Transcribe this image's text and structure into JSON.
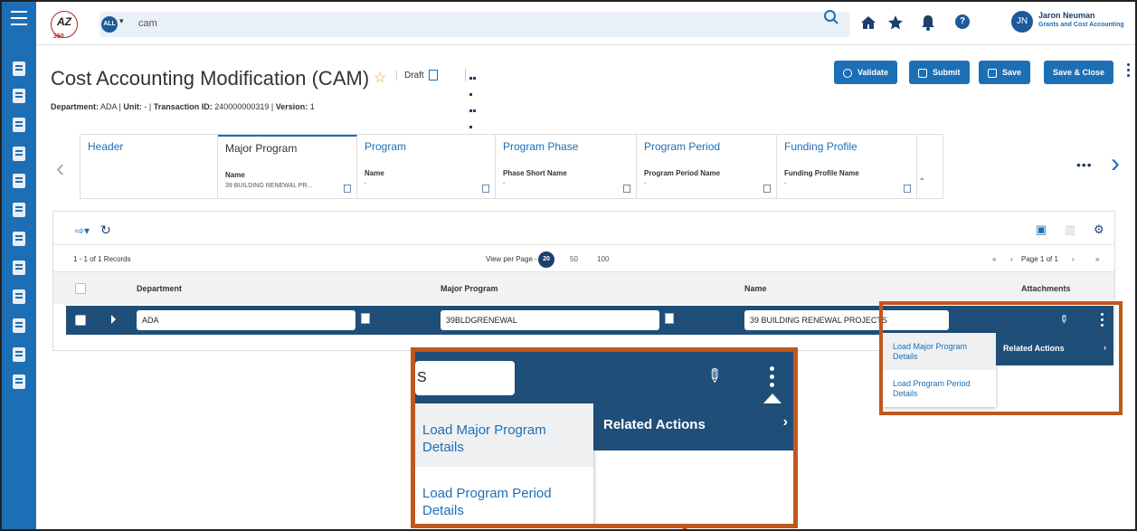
{
  "app": {
    "logo_text": "AZ",
    "logo_sub": "360",
    "search": {
      "scope": "ALL",
      "query": "cam"
    },
    "user": {
      "initials": "JN",
      "name": "Jaron Neuman",
      "role": "Grants and Cost Accounting"
    }
  },
  "page": {
    "title": "Cost Accounting Modification (CAM)",
    "status": "Draft",
    "meta": {
      "department_label": "Department:",
      "department": "ADA",
      "unit_label": "Unit:",
      "unit": "-",
      "txn_label": "Transaction ID:",
      "txn": "240000000319",
      "version_label": "Version:",
      "version": "1"
    },
    "actions": {
      "validate": "Validate",
      "submit": "Submit",
      "save": "Save",
      "save_close": "Save & Close"
    }
  },
  "tabs": [
    {
      "label": "Header"
    },
    {
      "label": "Major Program",
      "field": "Name",
      "value": "39 BUILDING RENEWAL PR..."
    },
    {
      "label": "Program",
      "field": "Name",
      "value": "-"
    },
    {
      "label": "Program Phase",
      "field": "Phase Short Name",
      "value": "-"
    },
    {
      "label": "Program Period",
      "field": "Program Period Name",
      "value": "-"
    },
    {
      "label": "Funding Profile",
      "field": "Funding Profile Name",
      "value": "-"
    }
  ],
  "grid": {
    "record_count": "1 - 1 of 1 Records",
    "view_per_page": "View per Page -",
    "page_sizes": [
      "20",
      "50",
      "100"
    ],
    "page_label": "Page 1 of 1",
    "columns": [
      "Department",
      "Major Program",
      "Name",
      "Attachments"
    ],
    "rows": [
      {
        "department": "ADA",
        "major_program": "39BLDGRENEWAL",
        "name": "39 BUILDING RENEWAL PROJECTS"
      }
    ]
  },
  "menu": {
    "items": [
      "Load Major Program Details",
      "Load Program Period Details"
    ],
    "related_actions": "Related Actions"
  },
  "zoom": {
    "input_fragment": "S"
  },
  "colors": {
    "accent": "#1d6fb5",
    "row": "#1f4e79",
    "callout": "#c0581d"
  }
}
